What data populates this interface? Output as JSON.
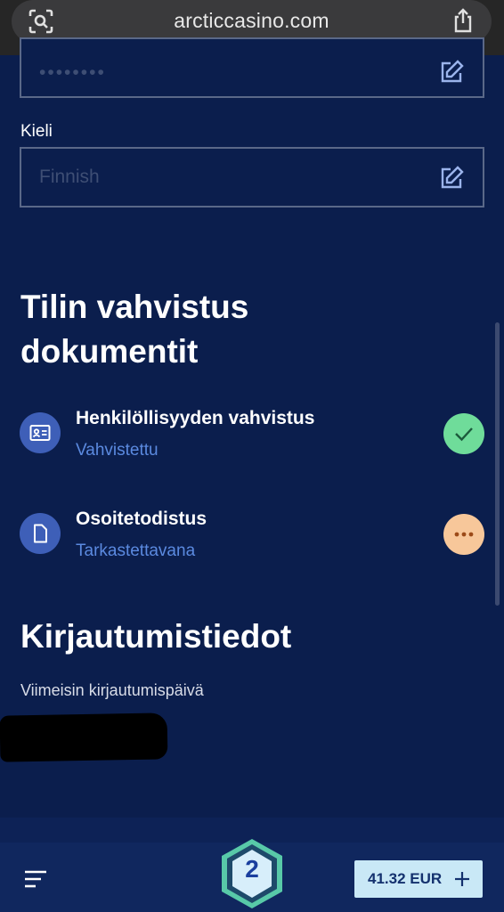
{
  "browser": {
    "url": "arcticcasino.com",
    "lens_icon": "camera-search-icon",
    "share_icon": "share-icon"
  },
  "form": {
    "password_value": "••••••••",
    "language_label": "Kieli",
    "language_value": "Finnish",
    "edit_icon": "edit-icon"
  },
  "documents": {
    "title": "Tilin vahvistus dokumentit",
    "items": [
      {
        "title": "Henkilöllisyyden vahvistus",
        "status": "Vahvistettu",
        "icon": "id-card-icon",
        "state_icon": "check-icon",
        "state_color": "#6fdc9a"
      },
      {
        "title": "Osoitetodistus",
        "status": "Tarkastettavana",
        "icon": "document-icon",
        "state_icon": "more-dots-icon",
        "state_color": "#f7c79a"
      }
    ]
  },
  "login": {
    "title": "Kirjautumistiedot",
    "last_login_label": "Viimeisin kirjautumispäivä"
  },
  "bottom_nav": {
    "menu_icon": "hamburger-menu-icon",
    "level": "2",
    "balance": "41.32 EUR",
    "plus_icon": "plus-icon"
  },
  "colors": {
    "background": "#0b1e4d",
    "accent_blue": "#5b8ae0",
    "verified": "#6fdc9a",
    "pending": "#f7c79a"
  }
}
